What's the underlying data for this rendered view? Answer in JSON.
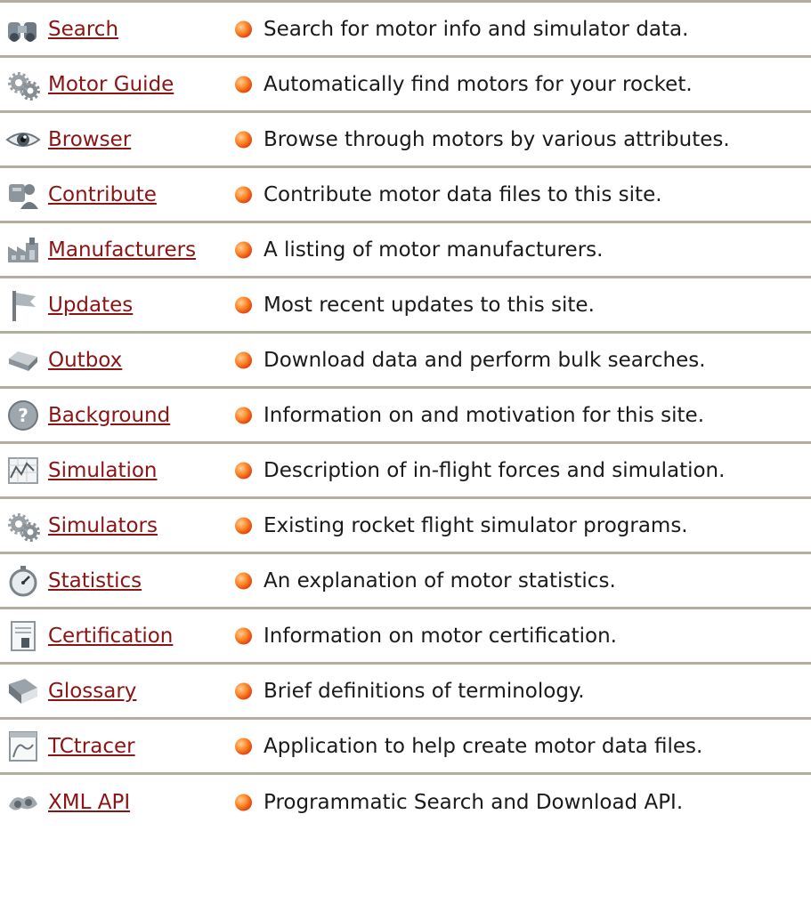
{
  "menu": {
    "items": [
      {
        "label": "Search",
        "description": "Search for motor info and simulator data.",
        "icon": "binoculars-icon"
      },
      {
        "label": "Motor Guide",
        "description": "Automatically find motors for your rocket.",
        "icon": "gears-icon"
      },
      {
        "label": "Browser",
        "description": "Browse through motors by various attributes.",
        "icon": "eye-icon"
      },
      {
        "label": "Contribute",
        "description": "Contribute motor data files to this site.",
        "icon": "contribute-icon"
      },
      {
        "label": "Manufacturers",
        "description": "A listing of motor manufacturers.",
        "icon": "factory-icon"
      },
      {
        "label": "Updates",
        "description": "Most recent updates to this site.",
        "icon": "flag-icon"
      },
      {
        "label": "Outbox",
        "description": "Download data and perform bulk searches.",
        "icon": "outbox-tray-icon"
      },
      {
        "label": "Background",
        "description": "Information on and motivation for this site.",
        "icon": "question-icon"
      },
      {
        "label": "Simulation",
        "description": "Description of in-flight forces and simulation.",
        "icon": "chart-icon"
      },
      {
        "label": "Simulators",
        "description": "Existing rocket flight simulator programs.",
        "icon": "gears-icon"
      },
      {
        "label": "Statistics",
        "description": "An explanation of motor statistics.",
        "icon": "stopwatch-icon"
      },
      {
        "label": "Certification",
        "description": "Information on motor certification.",
        "icon": "certificate-icon"
      },
      {
        "label": "Glossary",
        "description": "Brief definitions of terminology.",
        "icon": "book-icon"
      },
      {
        "label": "TCtracer",
        "description": "Application to help create motor data files.",
        "icon": "tracer-icon"
      },
      {
        "label": "XML API",
        "description": "Programmatic Search and Download API.",
        "icon": "api-icon"
      }
    ]
  },
  "colors": {
    "link": "#8b1414",
    "text": "#1a1a1a",
    "divider": "#b4aea0",
    "bullet": "#ff6a1a"
  }
}
